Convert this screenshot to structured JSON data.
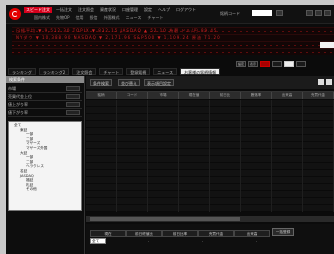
{
  "menu": {
    "top_items": [
      "スピード注文",
      "一括注文",
      "注文照会",
      "資産状況",
      "口座管理",
      "設定",
      "ヘルプ",
      "ログアウト"
    ],
    "active_index": 0,
    "sub_items": [
      "国内株式",
      "先物OP",
      "信用",
      "投信",
      "外国株式",
      "ニュース",
      "チャート"
    ],
    "code_label": "銘柄コード"
  },
  "ticker": {
    "line1": "日経平均 ▼ 9,512.30  TOPIX ▼ 832.15  JASDAQ ▲ 52.10  為替 ドル/円 89.45",
    "line2": "NYダウ ▼ 10,388.90  NASDAQ ▼ 2,171.96  S&P500 ▼ 1,109.24  原油 71.20"
  },
  "controls": [
    "設定",
    "表示",
    "",
    ""
  ],
  "tabs": [
    "ランキング",
    "ランキング2",
    "注文照会",
    "チャート",
    "登録銘柄",
    "ニュース",
    "お客様の銘柄情報"
  ],
  "active_tab": 6,
  "left_panel": {
    "header": "検索条件",
    "rows": [
      "市場",
      "売買代金上位",
      "値上がり率",
      "値下がり率"
    ],
    "tree": [
      {
        "label": "全て",
        "level": 1
      },
      {
        "label": "東証",
        "level": 2
      },
      {
        "label": "一部",
        "level": 3
      },
      {
        "label": "二部",
        "level": 3
      },
      {
        "label": "マザーズ",
        "level": 3
      },
      {
        "label": "マザーズ外国",
        "level": 3
      },
      {
        "label": "大証",
        "level": 2
      },
      {
        "label": "一部",
        "level": 3
      },
      {
        "label": "二部",
        "level": 3
      },
      {
        "label": "ヘラクレス",
        "level": 3
      },
      {
        "label": "名証",
        "level": 2
      },
      {
        "label": "JASDAQ",
        "level": 2
      },
      {
        "label": "福証",
        "level": 3
      },
      {
        "label": "札証",
        "level": 3
      },
      {
        "label": "その他",
        "level": 3
      }
    ]
  },
  "main": {
    "toolbar": [
      "条件検索",
      "並び替え",
      "表示項目設定"
    ],
    "columns": [
      "銘柄",
      "コード",
      "市場",
      "現在値",
      "前日比",
      "騰落率",
      "出来高",
      "売買代金"
    ],
    "bottom_headers": [
      "現在",
      "前日終値比",
      "前日比率",
      "売買代金",
      "出来高"
    ],
    "bottom_select": "全て",
    "bottom_cells": [
      "",
      "-",
      "",
      "-",
      "",
      "-"
    ],
    "bottom_badge": "一括登録"
  }
}
